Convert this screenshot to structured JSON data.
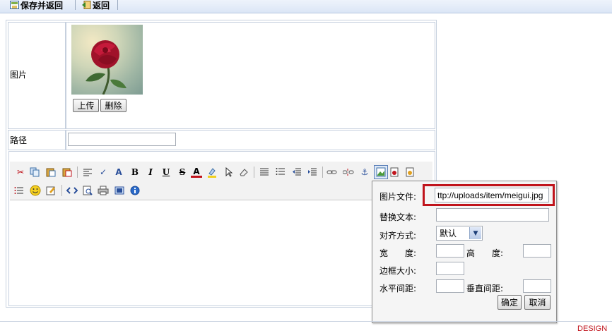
{
  "toolbar": {
    "save_return_label": "保存并返回",
    "return_label": "返回"
  },
  "form": {
    "image_label": "图片",
    "upload_label": "上传",
    "delete_label": "删除",
    "path_label": "路径",
    "path_value": ""
  },
  "editor": {
    "tools_row1": [
      "cut-icon",
      "copy-icon",
      "paste-icon",
      "paste-text-icon",
      "format-icon",
      "spellcheck-icon",
      "font-size-icon",
      "bold-icon",
      "italic-icon",
      "underline-icon",
      "strikethrough-icon",
      "font-color-icon",
      "highlight-icon",
      "select-icon",
      "eraser-icon",
      "justify-left-icon",
      "list-icon",
      "outdent-icon",
      "indent-icon",
      "link-icon",
      "unlink-icon",
      "anchor-icon",
      "image-icon",
      "flash-icon",
      "media-icon"
    ],
    "tools_row2": [
      "bulleted-list-icon",
      "emoticon-icon",
      "edit-icon",
      "source-icon",
      "preview-icon",
      "print-icon",
      "fullscreen-icon",
      "about-icon"
    ],
    "bold_glyph": "B",
    "italic_glyph": "I",
    "underline_glyph": "U",
    "strike_glyph": "S",
    "fontcolor_glyph": "A"
  },
  "image_dialog": {
    "file_label": "图片文件:",
    "file_value": "ttp://uploads/item/meigui.jpg",
    "alt_label": "替换文本:",
    "alt_value": "",
    "align_label": "对齐方式:",
    "align_value": "默认",
    "width_label": "宽　　度:",
    "height_label": "高　　度:",
    "border_label": "边框大小:",
    "hspace_label": "水平间距:",
    "vspace_label": "垂直间距:",
    "ok_label": "确定",
    "cancel_label": "取消"
  },
  "footer": {
    "brand_text": "DESIGN"
  },
  "colors": {
    "highlight_box": "#c0141c",
    "border": "#c6d0de"
  }
}
